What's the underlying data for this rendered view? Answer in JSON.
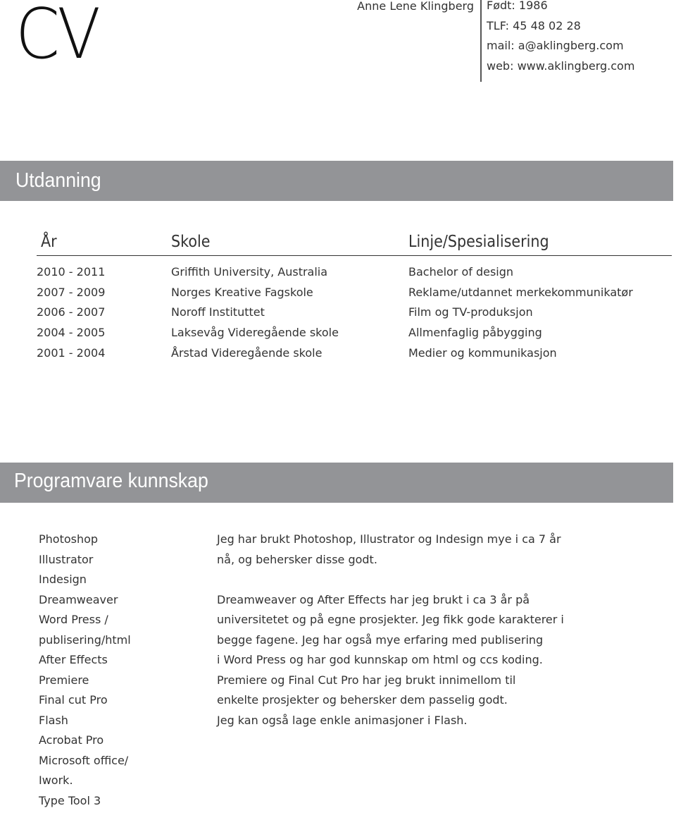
{
  "header": {
    "title": "CV",
    "name": "Anne Lene Klingberg",
    "contact": [
      "Født: 1986",
      "TLF: 45 48 02 28",
      "mail: a@aklingberg.com",
      "web: www.aklingberg.com"
    ]
  },
  "education": {
    "section_title": "Utdanning",
    "columns": [
      "År",
      "Skole",
      "Linje/Spesialisering"
    ],
    "rows": [
      {
        "year": "2010 - 2011",
        "school": "Griffith University,  Australia",
        "line": "Bachelor of design"
      },
      {
        "year": "2007 - 2009",
        "school": "Norges Kreative Fagskole",
        "line": "Reklame/utdannet merkekommunikatør"
      },
      {
        "year": "2006 - 2007",
        "school": "Noroff Instituttet",
        "line": "Film og TV-produksjon"
      },
      {
        "year": "2004 - 2005",
        "school": "Laksevåg Videregående skole",
        "line": "Allmenfaglig påbygging"
      },
      {
        "year": "2001 - 2004",
        "school": "Årstad Videregående skole",
        "line": "Medier og kommunikasjon"
      }
    ]
  },
  "software": {
    "section_title": "Programvare kunnskap",
    "items": [
      "Photoshop",
      "Illustrator",
      "Indesign",
      "Dreamweaver",
      "Word Press /",
      "publisering/html",
      "After Effects",
      "Premiere",
      "Final cut Pro",
      "Flash",
      "Acrobat Pro",
      "Microsoft office/",
      "Iwork.",
      "Type Tool 3"
    ],
    "description_lines": [
      "Jeg har brukt Photoshop, Illustrator og Indesign mye i ca 7 år",
      "nå, og behersker disse godt.",
      "",
      "Dreamweaver og After Effects har jeg brukt i ca 3 år på",
      "universitetet og på egne prosjekter.  Jeg fikk gode karakterer i",
      "begge fagene. Jeg har også mye erfaring med publisering",
      "i Word Press og har god kunnskap om html og ccs koding.",
      "Premiere og Final Cut Pro har jeg brukt innimellom til",
      "enkelte prosjekter og behersker dem passelig godt.",
      "Jeg kan også lage enkle animasjoner i Flash."
    ]
  }
}
